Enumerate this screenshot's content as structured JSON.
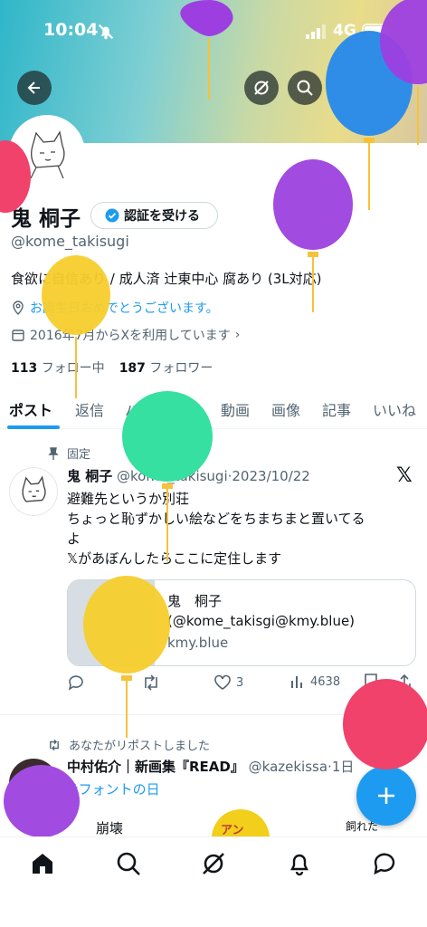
{
  "status": {
    "time": "10:04",
    "network": "4G"
  },
  "profile": {
    "name": "鬼 桐子",
    "verify_button": "認証を受ける",
    "handle": "@kome_takisugi",
    "bio": "食欲に自信あり / 成人済 辻東中心 腐あり (3L対応)",
    "birthday_text": "お誕生日おめでとうございます。",
    "joined": "2016年7月からXを利用しています",
    "following_count": "113",
    "following_label": "フォロー中",
    "followers_count": "187",
    "followers_label": "フォロワー"
  },
  "tabs": [
    "ポスト",
    "返信",
    "ハイライト",
    "動画",
    "画像",
    "記事",
    "いいね"
  ],
  "pinned_tweet": {
    "pinned_label": "固定",
    "author": "鬼 桐子",
    "handle": "@kome_takisugi",
    "date": "·2023/10/22",
    "lines": [
      "避難先というか別荘",
      "ちょっと恥ずかしい絵などをちまちまと置いてる",
      "よ",
      "𝕏があぼんしたらここに定住します"
    ],
    "card_title_1": "鬼　桐子",
    "card_title_2": "(@kome_takisgi@kmy.blue)",
    "card_domain": "kmy.blue",
    "likes": "3",
    "views": "4638"
  },
  "second_tweet": {
    "repost_label": "あなたがリポストしました",
    "author": "中村佑介｜新画集『READ』",
    "handle": "@kazekissa",
    "date": "·1日",
    "hashtag": "#フォントの日",
    "media_text_1": "崩壊",
    "media_text_2": "アン",
    "media_text_3": "飼れた"
  },
  "colors": {
    "accent": "#1d9bf0",
    "text": "#0f1419",
    "muted": "#536471"
  },
  "icons": [
    "back-arrow-icon",
    "grok-icon",
    "search-icon",
    "edit-icon",
    "share-icon",
    "location-icon",
    "calendar-icon",
    "pin-icon",
    "x-logo-icon",
    "reply-icon",
    "retweet-icon",
    "like-icon",
    "views-icon",
    "bookmark-icon",
    "repost-icon",
    "plus-icon",
    "home-icon",
    "notifications-icon",
    "messages-icon"
  ]
}
